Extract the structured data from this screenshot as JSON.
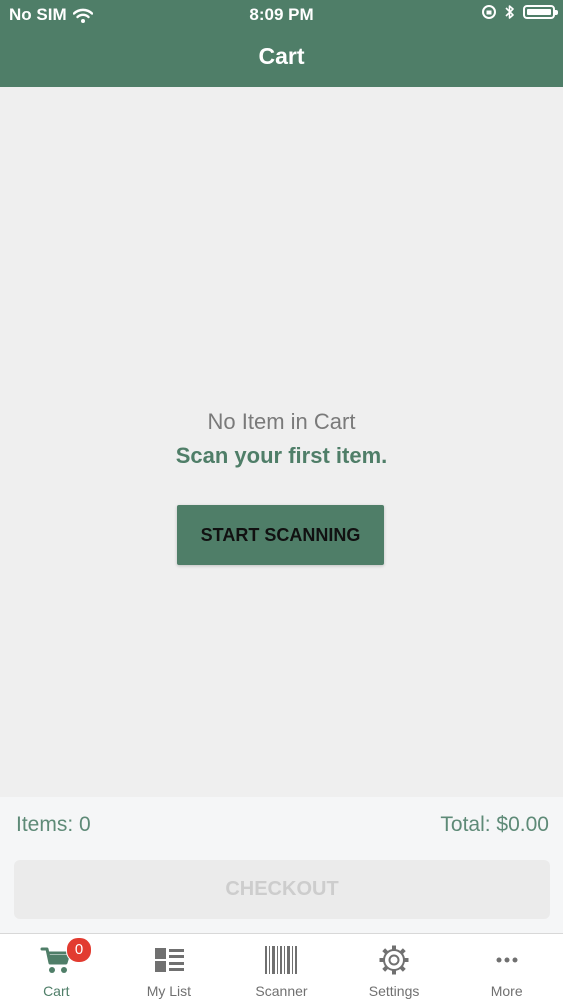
{
  "status_bar": {
    "carrier": "No SIM",
    "time": "8:09 PM"
  },
  "header": {
    "title": "Cart"
  },
  "empty_state": {
    "title": "No Item in Cart",
    "subtitle": "Scan your first item.",
    "button_label": "START SCANNING"
  },
  "summary": {
    "items_label": "Items:  0",
    "total_label": "Total:  $0.00",
    "checkout_label": "CHECKOUT"
  },
  "tabs": [
    {
      "label": "Cart",
      "icon": "cart-icon",
      "active": true,
      "badge": "0"
    },
    {
      "label": "My List",
      "icon": "list-icon",
      "active": false
    },
    {
      "label": "Scanner",
      "icon": "barcode-icon",
      "active": false
    },
    {
      "label": "Settings",
      "icon": "gear-icon",
      "active": false
    },
    {
      "label": "More",
      "icon": "more-icon",
      "active": false
    }
  ],
  "colors": {
    "brand": "#4f7e68",
    "badge": "#e23b30",
    "background": "#efefef"
  }
}
